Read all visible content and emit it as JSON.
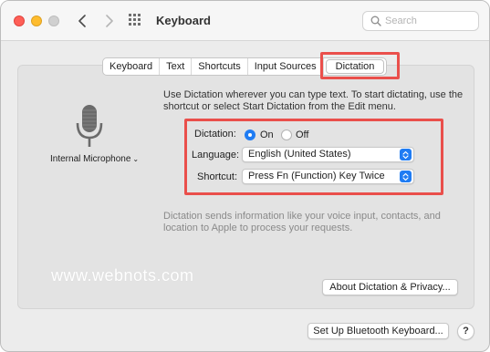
{
  "window": {
    "title": "Keyboard"
  },
  "search": {
    "placeholder": "Search"
  },
  "tabs": [
    {
      "label": "Keyboard",
      "active": false
    },
    {
      "label": "Text",
      "active": false
    },
    {
      "label": "Shortcuts",
      "active": false
    },
    {
      "label": "Input Sources",
      "active": false
    },
    {
      "label": "Dictation",
      "active": true
    }
  ],
  "microphone": {
    "label": "Internal Microphone"
  },
  "description": "Use Dictation wherever you can type text. To start dictating, use the shortcut or select Start Dictation from the Edit menu.",
  "dictation": {
    "label": "Dictation:",
    "on_label": "On",
    "off_label": "Off",
    "selected": "On"
  },
  "language": {
    "label": "Language:",
    "value": "English (United States)"
  },
  "shortcut": {
    "label": "Shortcut:",
    "value": "Press Fn (Function) Key Twice"
  },
  "privacy_note": "Dictation sends information like your voice input, contacts, and location to Apple to process your requests.",
  "watermark": "www.webnots.com",
  "buttons": {
    "about": "About Dictation & Privacy...",
    "bluetooth": "Set Up Bluetooth Keyboard...",
    "help": "?"
  },
  "colors": {
    "accent": "#1f7cf3",
    "highlight": "#ea4f4b",
    "close": "#fe5f57",
    "minimize": "#febc2e"
  },
  "icons": {
    "back": "chevron-left-icon",
    "forward": "chevron-right-icon",
    "grid": "grid-icon",
    "search": "search-icon",
    "microphone": "microphone-icon"
  }
}
